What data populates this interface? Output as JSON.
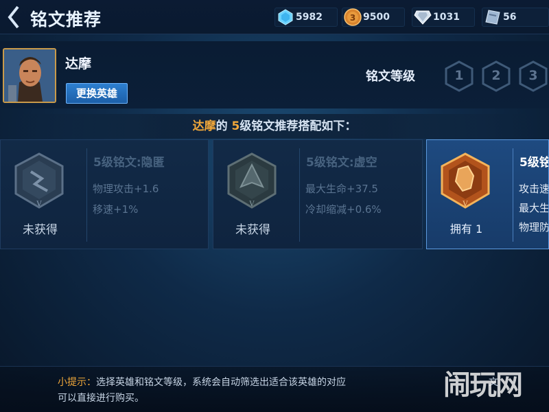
{
  "header": {
    "title": "铭文推荐",
    "currencies": [
      {
        "icon": "diamond-icon",
        "value": "5982"
      },
      {
        "icon": "gold-coin-icon",
        "value": "9500"
      },
      {
        "icon": "crystal-icon",
        "value": "1031"
      },
      {
        "icon": "ticket-icon",
        "value": "56"
      }
    ]
  },
  "hero": {
    "name": "达摩",
    "change_button": "更换英雄"
  },
  "levels": {
    "label": "铭文等级",
    "items": [
      "1",
      "2",
      "3"
    ]
  },
  "recommend": {
    "hero": "达摩",
    "of": "的",
    "level": "5",
    "text": "级铭文推荐搭配如下："
  },
  "cards": [
    {
      "name": "5级铭文:隐匿",
      "stats": [
        "物理攻击+1.6",
        "移速+1%"
      ],
      "status": "未获得",
      "owned": false
    },
    {
      "name": "5级铭文:虚空",
      "stats": [
        "最大生命+37.5",
        "冷却缩减+0.6%"
      ],
      "status": "未获得",
      "owned": false
    },
    {
      "name": "5级铭",
      "stats": [
        "攻击速",
        "最大生",
        "物理防"
      ],
      "status": "拥有 1",
      "owned": true
    }
  ],
  "tip": {
    "label": "小提示：",
    "line1": "选择英雄和铭文等级，系统会自动筛选出适合该英雄的对应",
    "line2": "可以直接进行购买。",
    "line1_tail": "文"
  },
  "watermark": "闹玩网",
  "colors": {
    "accent_orange": "#f2a83a",
    "button_blue": "#2d7fcf",
    "owned_card": "#1e4a80"
  }
}
